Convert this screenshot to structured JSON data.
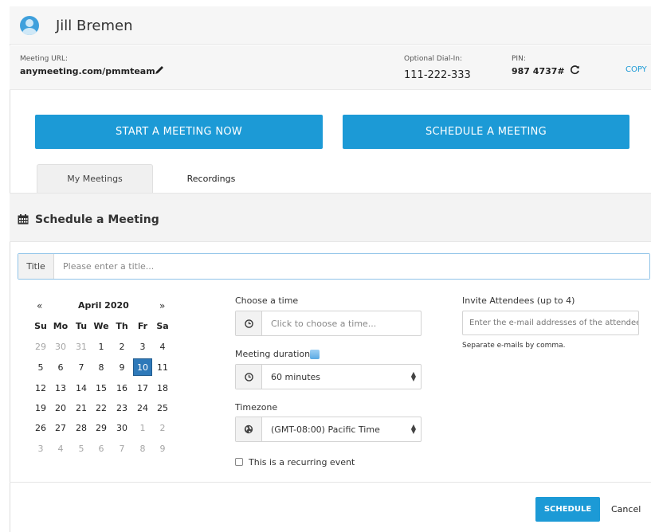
{
  "header": {
    "user_name": "Jill Bremen"
  },
  "meeting_info": {
    "url_label": "Meeting URL:",
    "url_value": "anymeeting.com/pmmteam",
    "dialin_label": "Optional Dial-In:",
    "dialin_value": "111-222-333",
    "pin_label": "PIN:",
    "pin_value": "987 4737#",
    "copy_label": "COPY"
  },
  "actions": {
    "start_label": "START A MEETING NOW",
    "schedule_label": "SCHEDULE A MEETING"
  },
  "tabs": [
    {
      "label": "My Meetings",
      "active": true
    },
    {
      "label": "Recordings",
      "active": false
    }
  ],
  "schedule": {
    "section_title": "Schedule a Meeting",
    "title_label": "Title",
    "title_placeholder": "Please enter a title...",
    "time_label": "Choose a time",
    "time_placeholder": "Click to choose a time...",
    "duration_label": "Meeting duration",
    "duration_value": "60 minutes",
    "timezone_label": "Timezone",
    "timezone_value": "(GMT-08:00) Pacific Time",
    "recurring_label": "This is a recurring event",
    "invite_label": "Invite Attendees (up to 4)",
    "invite_placeholder": "Enter the e-mail addresses of the attendees",
    "invite_hint": "Separate e-mails by comma.",
    "submit_label": "SCHEDULE",
    "cancel_label": "Cancel"
  },
  "calendar": {
    "prev": "«",
    "next": "»",
    "month": "April 2020",
    "weekdays": [
      "Su",
      "Mo",
      "Tu",
      "We",
      "Th",
      "Fr",
      "Sa"
    ],
    "weeks": [
      [
        "29",
        "30",
        "31",
        "1",
        "2",
        "3",
        "4"
      ],
      [
        "5",
        "6",
        "7",
        "8",
        "9",
        "10",
        "11"
      ],
      [
        "12",
        "13",
        "14",
        "15",
        "16",
        "17",
        "18"
      ],
      [
        "19",
        "20",
        "21",
        "22",
        "23",
        "24",
        "25"
      ],
      [
        "26",
        "27",
        "28",
        "29",
        "30",
        "1",
        "2"
      ],
      [
        "3",
        "4",
        "5",
        "6",
        "7",
        "8",
        "9"
      ]
    ],
    "selected": "10"
  },
  "colors": {
    "accent": "#1c9ad6",
    "selected_day": "#2e79b9"
  },
  "icons": {
    "avatar": "user-avatar-icon",
    "edit": "pencil-icon",
    "refresh": "refresh-icon",
    "calendar": "calendar-icon",
    "clock": "clock-icon",
    "globe": "globe-icon",
    "info": "info-icon"
  }
}
